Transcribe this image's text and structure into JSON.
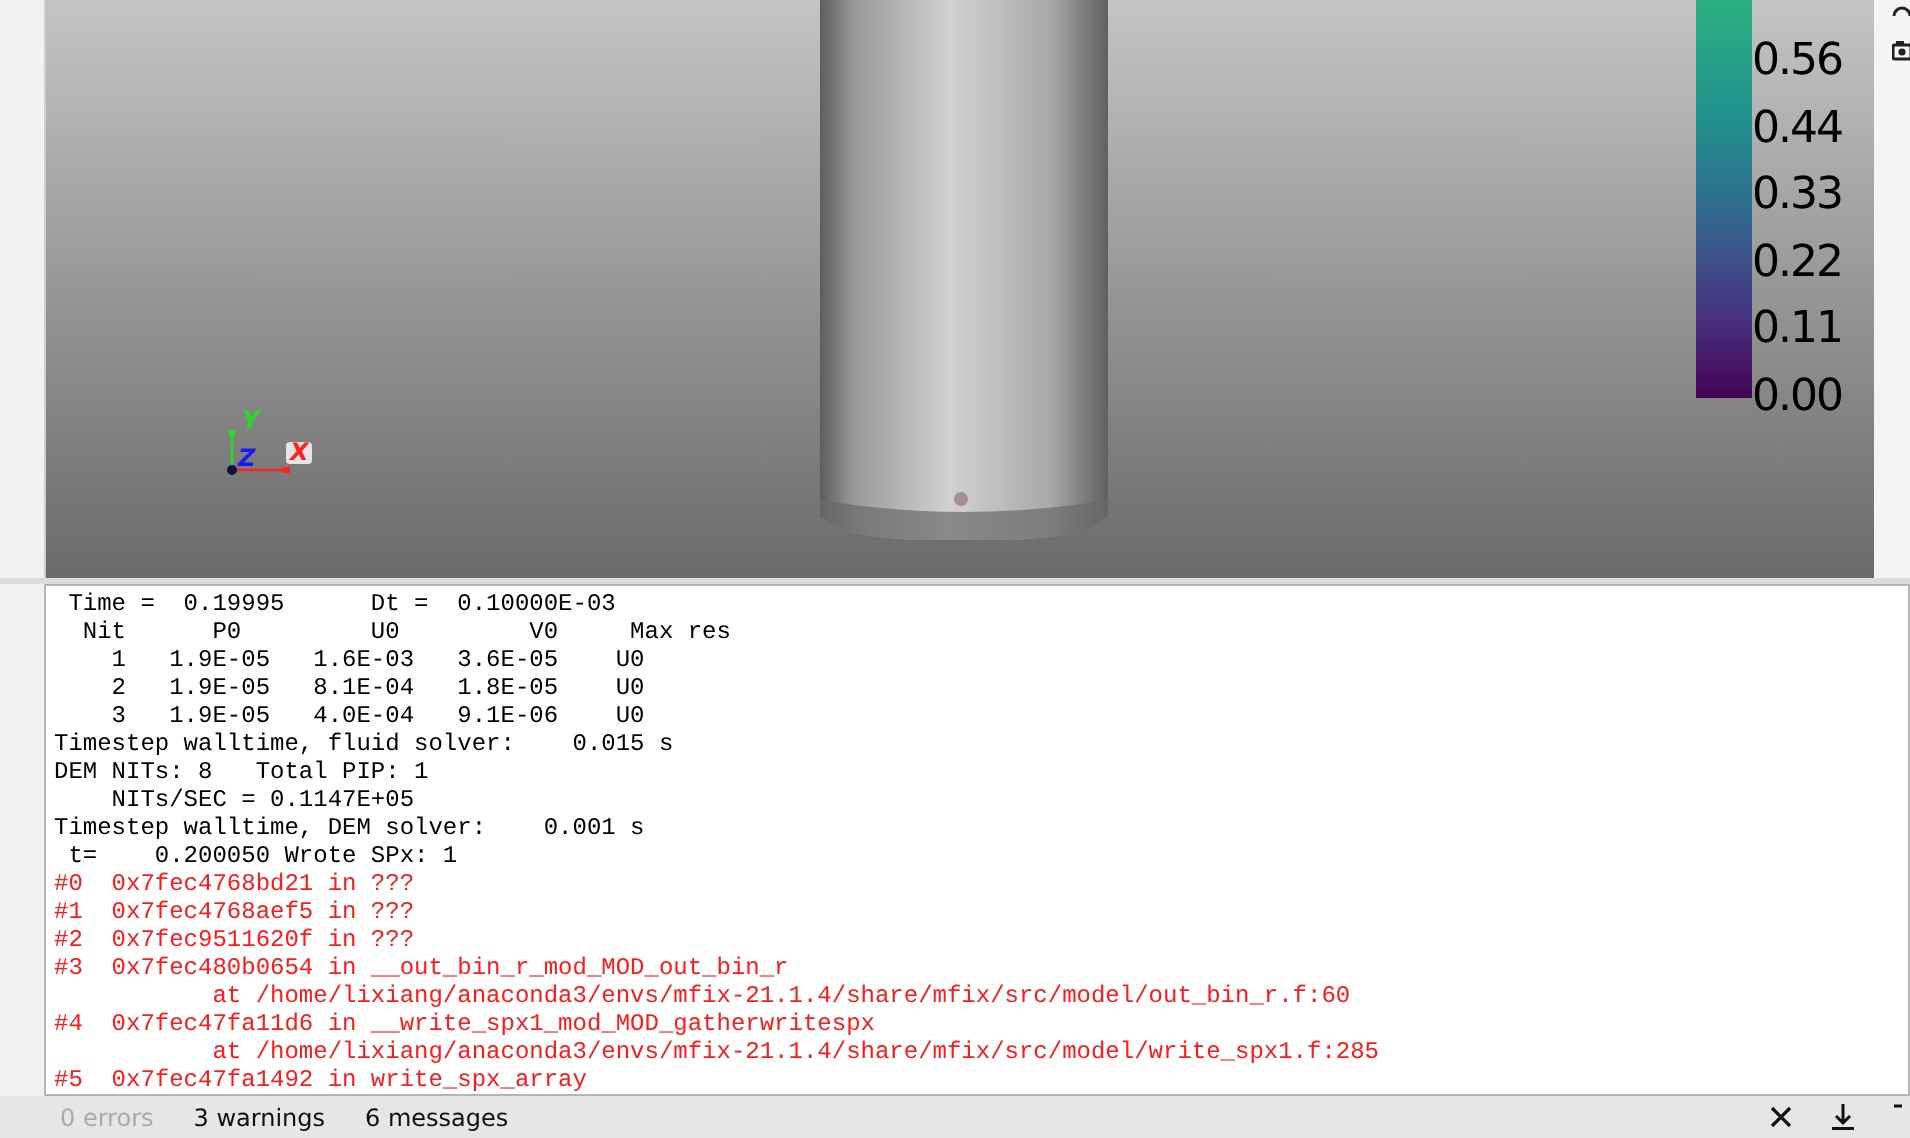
{
  "viewport": {
    "axes": [
      {
        "label": "Y",
        "color": "#22dd22"
      },
      {
        "label": "Z",
        "color": "#1a1aff"
      },
      {
        "label": "X",
        "color": "#ff2222"
      }
    ],
    "colorbar": {
      "labels": [
        "0.56",
        "0.44",
        "0.33",
        "0.22",
        "0.11",
        "0.00"
      ]
    }
  },
  "console": {
    "lines": [
      {
        "kind": "normal",
        "text": " Time =  0.19995      Dt =  0.10000E-03"
      },
      {
        "kind": "normal",
        "text": "  Nit      P0         U0         V0     Max res"
      },
      {
        "kind": "normal",
        "text": "    1   1.9E-05   1.6E-03   3.6E-05    U0"
      },
      {
        "kind": "normal",
        "text": "    2   1.9E-05   8.1E-04   1.8E-05    U0"
      },
      {
        "kind": "normal",
        "text": "    3   1.9E-05   4.0E-04   9.1E-06    U0"
      },
      {
        "kind": "normal",
        "text": "Timestep walltime, fluid solver:    0.015 s"
      },
      {
        "kind": "normal",
        "text": "DEM NITs: 8   Total PIP: 1"
      },
      {
        "kind": "normal",
        "text": "    NITs/SEC = 0.1147E+05"
      },
      {
        "kind": "normal",
        "text": "Timestep walltime, DEM solver:    0.001 s"
      },
      {
        "kind": "normal",
        "text": " t=    0.200050 Wrote SPx: 1"
      },
      {
        "kind": "error",
        "text": "#0  0x7fec4768bd21 in ???"
      },
      {
        "kind": "error",
        "text": "#1  0x7fec4768aef5 in ???"
      },
      {
        "kind": "error",
        "text": "#2  0x7fec9511620f in ???"
      },
      {
        "kind": "error",
        "text": "#3  0x7fec480b0654 in __out_bin_r_mod_MOD_out_bin_r"
      },
      {
        "kind": "error",
        "text": "           at /home/lixiang/anaconda3/envs/mfix-21.1.4/share/mfix/src/model/out_bin_r.f:60"
      },
      {
        "kind": "error",
        "text": "#4  0x7fec47fa11d6 in __write_spx1_mod_MOD_gatherwritespx"
      },
      {
        "kind": "error",
        "text": "           at /home/lixiang/anaconda3/envs/mfix-21.1.4/share/mfix/src/model/write_spx1.f:285"
      },
      {
        "kind": "error",
        "text": "#5  0x7fec47fa1492 in write_spx_array"
      }
    ]
  },
  "status_bar": {
    "counts": [
      {
        "label": "0 errors",
        "disabled": true
      },
      {
        "label": "3 warnings",
        "disabled": false
      },
      {
        "label": "6 messages",
        "disabled": false
      }
    ]
  }
}
